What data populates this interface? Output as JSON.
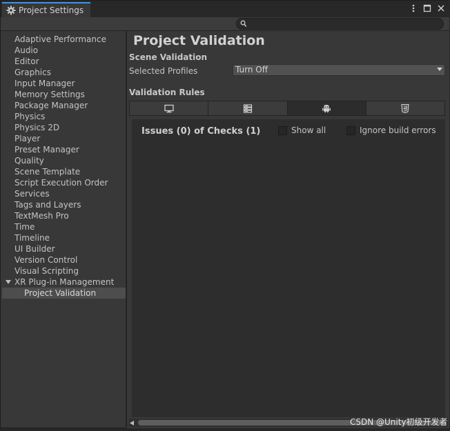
{
  "window": {
    "tab_title": "Project Settings",
    "accent": "#4a90d9"
  },
  "sidebar": {
    "items": [
      {
        "label": "Adaptive Performance"
      },
      {
        "label": "Audio"
      },
      {
        "label": "Editor"
      },
      {
        "label": "Graphics"
      },
      {
        "label": "Input Manager"
      },
      {
        "label": "Memory Settings"
      },
      {
        "label": "Package Manager"
      },
      {
        "label": "Physics"
      },
      {
        "label": "Physics 2D"
      },
      {
        "label": "Player"
      },
      {
        "label": "Preset Manager"
      },
      {
        "label": "Quality"
      },
      {
        "label": "Scene Template"
      },
      {
        "label": "Script Execution Order"
      },
      {
        "label": "Services"
      },
      {
        "label": "Tags and Layers"
      },
      {
        "label": "TextMesh Pro"
      },
      {
        "label": "Time"
      },
      {
        "label": "Timeline"
      },
      {
        "label": "UI Builder"
      },
      {
        "label": "Version Control"
      },
      {
        "label": "Visual Scripting"
      },
      {
        "label": "XR Plug-in Management",
        "expanded": true
      },
      {
        "label": "Project Validation",
        "selected": true
      }
    ]
  },
  "main": {
    "title": "Project Validation",
    "scene_validation_label": "Scene Validation",
    "selected_profiles_label": "Selected Profiles",
    "selected_profiles_value": "Turn Off",
    "validation_rules_label": "Validation Rules",
    "platform_tabs": [
      {
        "icon": "desktop-icon",
        "active": false
      },
      {
        "icon": "server-icon",
        "active": false
      },
      {
        "icon": "android-icon",
        "active": true
      },
      {
        "icon": "html5-icon",
        "active": false
      }
    ],
    "issues_summary": "Issues (0) of Checks (1)",
    "show_all_label": "Show all",
    "show_all_checked": false,
    "ignore_build_errors_label": "Ignore build errors",
    "ignore_build_errors_checked": false
  },
  "watermark": "CSDN @Unity初级开发者"
}
